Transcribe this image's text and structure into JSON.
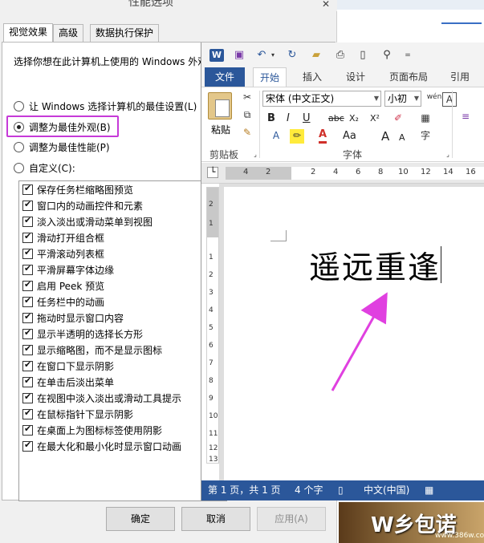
{
  "perf_dialog": {
    "title": "性能选项",
    "close": "✕",
    "tabs": [
      "视觉效果",
      "高级",
      "数据执行保护"
    ],
    "description": "选择你想在此计算机上使用的 Windows 外观",
    "radios": [
      {
        "label": "让 Windows 选择计算机的最佳设置(L)",
        "checked": false
      },
      {
        "label": "调整为最佳外观(B)",
        "checked": true
      },
      {
        "label": "调整为最佳性能(P)",
        "checked": false
      },
      {
        "label": "自定义(C):",
        "checked": false
      }
    ],
    "checkboxes": [
      "保存任务栏缩略图预览",
      "窗口内的动画控件和元素",
      "淡入淡出或滑动菜单到视图",
      "滑动打开组合框",
      "平滑滚动列表框",
      "平滑屏幕字体边缘",
      "启用 Peek 预览",
      "任务栏中的动画",
      "拖动时显示窗口内容",
      "显示半透明的选择长方形",
      "显示缩略图，而不是显示图标",
      "在窗口下显示阴影",
      "在单击后淡出菜单",
      "在视图中淡入淡出或滑动工具提示",
      "在鼠标指针下显示阴影",
      "在桌面上为图标标签使用阴影",
      "在最大化和最小化时显示窗口动画"
    ],
    "buttons": {
      "ok": "确定",
      "cancel": "取消",
      "apply": "应用(A)"
    },
    "highlight_color": "#c63ad8"
  },
  "word": {
    "qat_icons": [
      "word-icon",
      "save-icon",
      "undo-icon",
      "redo-icon",
      "open-icon",
      "print-preview-icon",
      "new-icon",
      "find-icon",
      "more-icon"
    ],
    "tabs": {
      "file": "文件",
      "home": "开始",
      "insert": "插入",
      "design": "设计",
      "layout": "页面布局",
      "references": "引用"
    },
    "ribbon": {
      "paste": "粘贴",
      "clipboard_group": "剪贴板",
      "font_name": "宋体 (中文正文)",
      "font_size": "小初",
      "wen": "wén",
      "font_group": "字体",
      "bold": "B",
      "italic": "I",
      "underline": "U",
      "strike": "abc",
      "subscript": "X₂",
      "superscript": "X²",
      "font_color_letter": "A",
      "aa": "Aa",
      "grow": "A",
      "shrink": "A",
      "circle_char": "字",
      "border_a": "A"
    },
    "ruler_numbers": [
      "4",
      "2",
      "2",
      "4",
      "6",
      "8",
      "10",
      "12",
      "14",
      "16"
    ],
    "vruler_numbers": [
      "2",
      "1",
      "1",
      "2",
      "3",
      "4",
      "5",
      "6",
      "7",
      "8",
      "9",
      "10",
      "11",
      "12",
      "13"
    ],
    "document_text": "遥远重逢",
    "status": {
      "page": "第 1 页，共 1 页",
      "words": "4 个字",
      "language": "中文(中国)"
    },
    "accent": "#2b579a"
  },
  "annotation": {
    "arrow_color": "#e040e0"
  },
  "watermark": {
    "text": "W乡包诺",
    "sub": "www.386w.com"
  }
}
